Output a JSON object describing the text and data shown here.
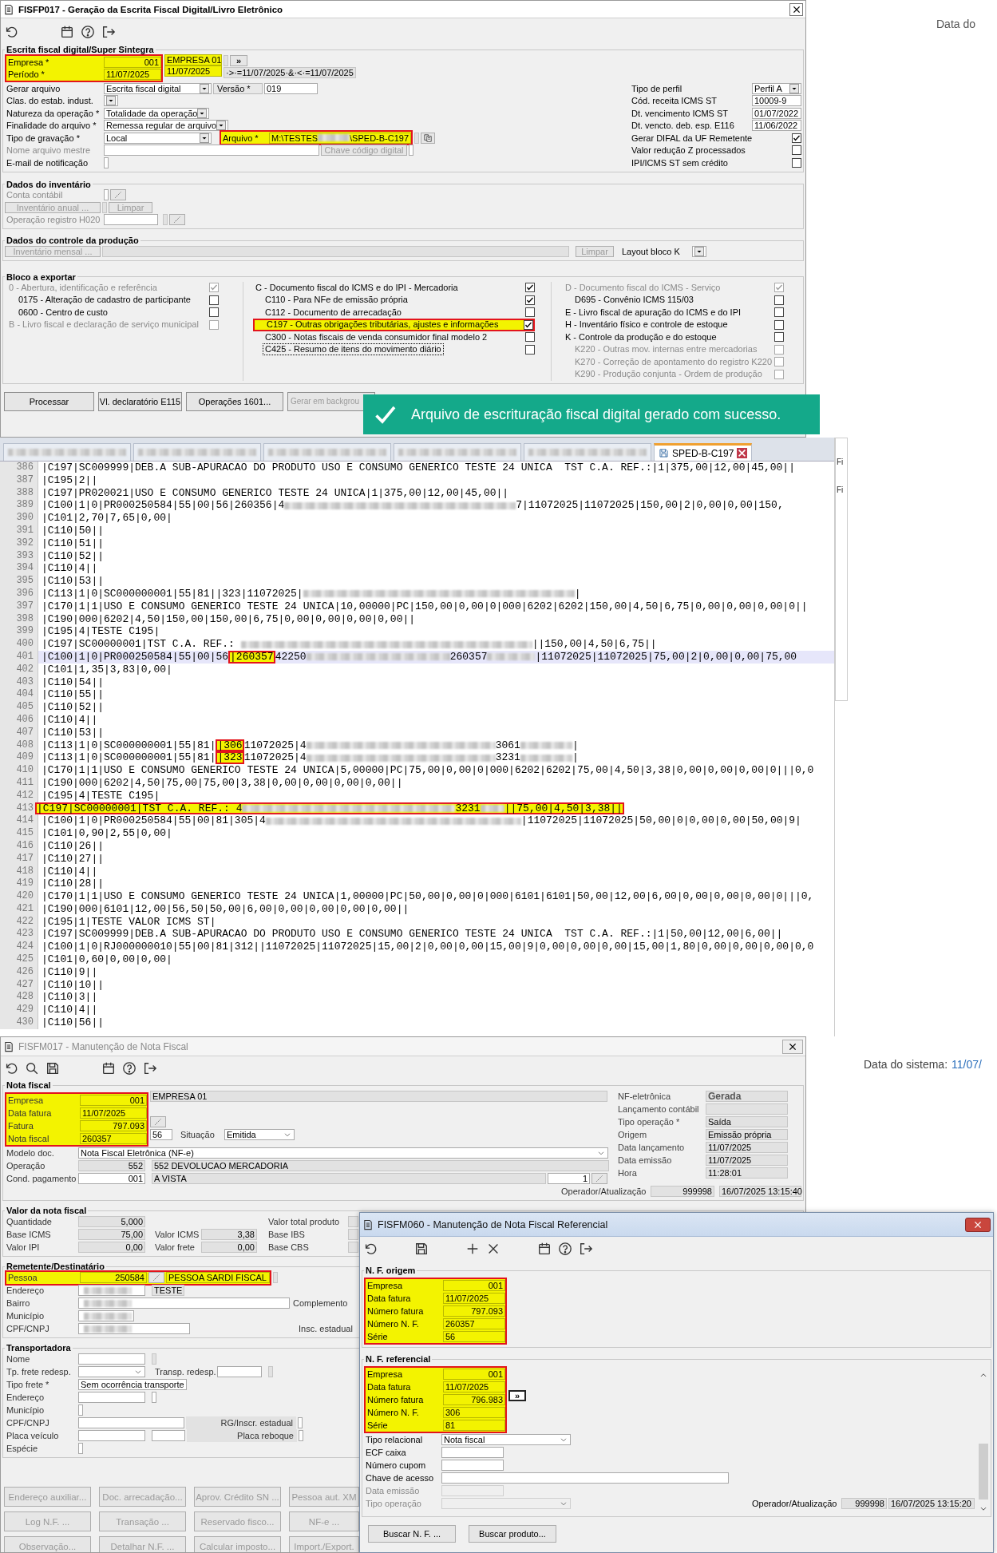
{
  "sped": {
    "title": "FISFP017 - Geração da Escrita Fiscal Digital/Livro Eletrônico",
    "section": "Escrita fiscal digital/Super Sintegra",
    "header": {
      "highlighted": true,
      "empresa": {
        "label": "Empresa *",
        "code": "001",
        "name": "EMPRESA 01"
      },
      "periodo": {
        "label": "Período *",
        "start": "11/07/2025",
        "end": "11/07/2025"
      },
      "filter": "·>·=11/07/2025·&·<·=11/07/2025",
      "expand": "»"
    },
    "gerar_arquivo": {
      "label": "Gerar arquivo",
      "value": "Escrita fiscal digital"
    },
    "versao": {
      "label": "Versão *",
      "value": "019"
    },
    "clas_estab": {
      "label": "Clas. do estab. indust."
    },
    "natureza": {
      "label": "Natureza da operação *",
      "value": "Totalidade da operação"
    },
    "finalidade": {
      "label": "Finalidade do arquivo *",
      "value": "Remessa regular de arquivo"
    },
    "tipo_gravacao": {
      "label": "Tipo de gravação *",
      "value": "Local"
    },
    "arquivo": {
      "label": "Arquivo *",
      "value_start": "M:\\TESTES",
      "value_end": "\\SPED-B-C197",
      "highlighted": true
    },
    "chave": {
      "text": "Chave código digital",
      "disabled": true
    },
    "nome_mestre": {
      "label": "Nome arquivo mestre",
      "disabled": true
    },
    "email": {
      "label": "E-mail de notificação"
    },
    "perfil": [
      {
        "label": "Tipo de perfil",
        "kind": "select",
        "value": "Perfil A"
      },
      {
        "label": "Cód. receita ICMS ST",
        "kind": "field",
        "value": "10009-9"
      },
      {
        "label": "Dt. vencimento ICMS ST",
        "kind": "field",
        "value": "01/07/2022"
      },
      {
        "label": "Dt. vencto. deb. esp. E116",
        "kind": "field",
        "value": "11/06/2022"
      },
      {
        "label": "Gerar DIFAL da UF Remetente",
        "kind": "check",
        "checked": true
      },
      {
        "label": "Valor redução Z processados",
        "kind": "check",
        "checked": false
      },
      {
        "label": "IPI/ICMS ST sem crédito",
        "kind": "check",
        "checked": false
      }
    ],
    "inventario": {
      "title": "Dados do inventário",
      "conta": {
        "label": "Conta contábil",
        "disabled": true
      },
      "anual": {
        "text": "Inventário anual ...",
        "disabled": true
      },
      "limpar": {
        "text": "Limpar",
        "disabled": true
      },
      "h020": {
        "label": "Operação registro H020",
        "disabled": true
      }
    },
    "producao": {
      "title": "Dados do controle da produção",
      "mensal": {
        "text": "Inventário mensal ...",
        "disabled": true
      },
      "limpar": {
        "text": "Limpar",
        "disabled": true
      },
      "layout": {
        "label": "Layout bloco K"
      }
    },
    "blocos": {
      "title": "Bloco a exportar",
      "columns": [
        [
          {
            "label": "0 - Abertura, identificação e referência",
            "checked": true,
            "disabled": true,
            "highlighted": false,
            "focused": false,
            "children": [
              {
                "label": "0175 - Alteração de cadastro de participante",
                "checked": false,
                "disabled": false,
                "highlighted": false,
                "focused": false
              },
              {
                "label": "0600 - Centro de custo",
                "checked": false,
                "disabled": false,
                "highlighted": false,
                "focused": false
              }
            ]
          },
          {
            "label": "B - Livro fiscal e declaração de serviço municipal",
            "checked": false,
            "disabled": true,
            "highlighted": false,
            "focused": false
          }
        ],
        [
          {
            "label": "C - Documento fiscal do ICMS e do IPI - Mercadoria",
            "checked": true,
            "disabled": false,
            "highlighted": false,
            "focused": false,
            "children": [
              {
                "label": "C110 - Para NFe de emissão própria",
                "checked": true,
                "disabled": false,
                "highlighted": false,
                "focused": false
              },
              {
                "label": "C112 - Documento de arrecadação",
                "checked": false,
                "disabled": false,
                "highlighted": false,
                "focused": false
              },
              {
                "label": "C197 - Outras obrigações tributárias, ajustes e informações",
                "checked": true,
                "disabled": false,
                "highlighted": true,
                "focused": false
              },
              {
                "label": "C300 - Notas fiscais de venda consumidor final modelo 2",
                "checked": false,
                "disabled": false,
                "highlighted": false,
                "focused": false
              },
              {
                "label": "C425 - Resumo de itens do movimento diário",
                "checked": false,
                "disabled": false,
                "highlighted": false,
                "focused": true
              }
            ]
          }
        ],
        [
          {
            "label": "D - Documento fiscal do ICMS - Serviço",
            "checked": true,
            "disabled": true,
            "highlighted": false,
            "focused": false,
            "children": [
              {
                "label": "D695 - Convênio ICMS 115/03",
                "checked": false,
                "disabled": false,
                "highlighted": false,
                "focused": false
              }
            ]
          },
          {
            "label": "E - Livro fiscal de apuração do ICMS e do IPI",
            "checked": false,
            "disabled": false,
            "highlighted": false,
            "focused": false
          },
          {
            "label": "H - Inventário físico e controle de estoque",
            "checked": false,
            "disabled": false,
            "highlighted": false,
            "focused": false
          },
          {
            "label": "K - Controle da produção e do estoque",
            "checked": false,
            "disabled": false,
            "highlighted": false,
            "focused": false,
            "children": [
              {
                "label": "K220 - Outras mov. internas entre mercadorias",
                "checked": false,
                "disabled": true,
                "highlighted": false,
                "focused": false
              },
              {
                "label": "K270 - Correção de apontamento do registro K220",
                "checked": false,
                "disabled": true,
                "highlighted": false,
                "focused": false
              },
              {
                "label": "K290 - Produção conjunta - Ordem de produção",
                "checked": false,
                "disabled": true,
                "highlighted": false,
                "focused": false
              }
            ]
          }
        ]
      ]
    },
    "buttons": [
      {
        "text": "Processar",
        "disabled": false
      },
      {
        "text": "Vl. declaratório E115",
        "disabled": false
      },
      {
        "text": "Operações 1601...",
        "disabled": false
      },
      {
        "text": "Gerar em backgrou",
        "disabled": true
      }
    ]
  },
  "toast": {
    "message": "Arquivo de escrituração fiscal digital gerado com sucesso."
  },
  "right_top": {
    "text": "Data do"
  },
  "editor": {
    "tabs": [
      {
        "kind": "redacted",
        "selected": false
      },
      {
        "kind": "redacted",
        "selected": false
      },
      {
        "kind": "redacted",
        "selected": false
      },
      {
        "kind": "redacted",
        "selected": false
      },
      {
        "kind": "redacted",
        "selected": false
      },
      {
        "kind": "file",
        "label": "SPED-B-C197",
        "selected": true
      }
    ],
    "side_labels": [
      "Fi",
      "Fi"
    ],
    "lines": [
      {
        "num": "386",
        "current": false,
        "highlighted": false,
        "segments": [
          {
            "kind": "text",
            "text": "|C197|SC009999|DEB.A SUB-APURACAO DO PRODUTO USO E CONSUMO GENERICO TESTE 24 UNICA  TST C.A. REF.:|1|375,00|12,00|45,00||"
          }
        ]
      },
      {
        "num": "387",
        "current": false,
        "highlighted": false,
        "segments": [
          {
            "kind": "text",
            "text": "|C195|2||"
          }
        ]
      },
      {
        "num": "388",
        "current": false,
        "highlighted": false,
        "segments": [
          {
            "kind": "text",
            "text": "|C197|PR020021|USO E CONSUMO GENERICO TESTE 24 UNICA|1|375,00|12,00|45,00||"
          }
        ]
      },
      {
        "num": "389",
        "current": false,
        "highlighted": false,
        "segments": [
          {
            "kind": "text",
            "text": "|C100|1|0|PR000250584|55|00|56|260356|4"
          },
          {
            "kind": "redacted"
          },
          {
            "kind": "text",
            "text": "7|11072025|11072025|150,00|2|0,00|0,00|150,"
          }
        ]
      },
      {
        "num": "390",
        "current": false,
        "highlighted": false,
        "segments": [
          {
            "kind": "text",
            "text": "|C101|2,70|7,65|0,00|"
          }
        ]
      },
      {
        "num": "391",
        "current": false,
        "highlighted": false,
        "segments": [
          {
            "kind": "text",
            "text": "|C110|50||"
          }
        ]
      },
      {
        "num": "392",
        "current": false,
        "highlighted": false,
        "segments": [
          {
            "kind": "text",
            "text": "|C110|51||"
          }
        ]
      },
      {
        "num": "393",
        "current": false,
        "highlighted": false,
        "segments": [
          {
            "kind": "text",
            "text": "|C110|52||"
          }
        ]
      },
      {
        "num": "394",
        "current": false,
        "highlighted": false,
        "segments": [
          {
            "kind": "text",
            "text": "|C110|4||"
          }
        ]
      },
      {
        "num": "395",
        "current": false,
        "highlighted": false,
        "segments": [
          {
            "kind": "text",
            "text": "|C110|53||"
          }
        ]
      },
      {
        "num": "396",
        "current": false,
        "highlighted": false,
        "segments": [
          {
            "kind": "text",
            "text": "|C113|1|0|SC000000001|55|81||323|11072025|"
          },
          {
            "kind": "redacted"
          },
          {
            "kind": "text",
            "text": "|"
          }
        ]
      },
      {
        "num": "397",
        "current": false,
        "highlighted": false,
        "segments": [
          {
            "kind": "text",
            "text": "|C170|1|1|USO E CONSUMO GENERICO TESTE 24 UNICA|10,00000|PC|150,00|0,00|0|000|6202|6202|150,00|4,50|6,75|0,00|0,00|0,00|0||"
          }
        ]
      },
      {
        "num": "398",
        "current": false,
        "highlighted": false,
        "segments": [
          {
            "kind": "text",
            "text": "|C190|000|6202|4,50|150,00|150,00|6,75|0,00|0,00|0,00|0,00||"
          }
        ]
      },
      {
        "num": "399",
        "current": false,
        "highlighted": false,
        "segments": [
          {
            "kind": "text",
            "text": "|C195|4|TESTE C195|"
          }
        ]
      },
      {
        "num": "400",
        "current": false,
        "highlighted": false,
        "segments": [
          {
            "kind": "text",
            "text": "|C197|SC00000001|TST C.A. REF.: "
          },
          {
            "kind": "redacted"
          },
          {
            "kind": "text",
            "text": "||150,00|4,50|6,75||"
          }
        ]
      },
      {
        "num": "401",
        "current": true,
        "highlighted": false,
        "segments": [
          {
            "kind": "text",
            "text": "|C100|1|0|PR000250584|55|00|56"
          },
          {
            "kind": "mark",
            "text": "|260357"
          },
          {
            "kind": "text",
            "text": "42250"
          },
          {
            "kind": "redacted"
          },
          {
            "kind": "text",
            "text": "260357"
          },
          {
            "kind": "redacted"
          },
          {
            "kind": "text",
            "text": "|11072025|11072025|75,00|2|0,00|0,00|75,00"
          }
        ]
      },
      {
        "num": "402",
        "current": false,
        "highlighted": false,
        "segments": [
          {
            "kind": "text",
            "text": "|C101|1,35|3,83|0,00|"
          }
        ]
      },
      {
        "num": "403",
        "current": false,
        "highlighted": false,
        "segments": [
          {
            "kind": "text",
            "text": "|C110|54||"
          }
        ]
      },
      {
        "num": "404",
        "current": false,
        "highlighted": false,
        "segments": [
          {
            "kind": "text",
            "text": "|C110|55||"
          }
        ]
      },
      {
        "num": "405",
        "current": false,
        "highlighted": false,
        "segments": [
          {
            "kind": "text",
            "text": "|C110|52||"
          }
        ]
      },
      {
        "num": "406",
        "current": false,
        "highlighted": false,
        "segments": [
          {
            "kind": "text",
            "text": "|C110|4||"
          }
        ]
      },
      {
        "num": "407",
        "current": false,
        "highlighted": false,
        "segments": [
          {
            "kind": "text",
            "text": "|C110|53||"
          }
        ]
      },
      {
        "num": "408",
        "current": false,
        "highlighted": false,
        "segments": [
          {
            "kind": "text",
            "text": "|C113|1|0|SC000000001|55|81|"
          },
          {
            "kind": "mark",
            "text": "|306"
          },
          {
            "kind": "text",
            "text": "11072025|4"
          },
          {
            "kind": "redacted"
          },
          {
            "kind": "text",
            "text": "3061"
          },
          {
            "kind": "redacted"
          },
          {
            "kind": "text",
            "text": "|"
          }
        ]
      },
      {
        "num": "409",
        "current": false,
        "highlighted": false,
        "segments": [
          {
            "kind": "text",
            "text": "|C113|1|0|SC000000001|55|81|"
          },
          {
            "kind": "mark",
            "text": "|323"
          },
          {
            "kind": "text",
            "text": "11072025|4"
          },
          {
            "kind": "redacted"
          },
          {
            "kind": "text",
            "text": "3231"
          },
          {
            "kind": "redacted"
          },
          {
            "kind": "text",
            "text": "|"
          }
        ]
      },
      {
        "num": "410",
        "current": false,
        "highlighted": false,
        "segments": [
          {
            "kind": "text",
            "text": "|C170|1|1|USO E CONSUMO GENERICO TESTE 24 UNICA|5,00000|PC|75,00|0,00|0|000|6202|6202|75,00|4,50|3,38|0,00|0,00|0,00|0|||0,0"
          }
        ]
      },
      {
        "num": "411",
        "current": false,
        "highlighted": false,
        "segments": [
          {
            "kind": "text",
            "text": "|C190|000|6202|4,50|75,00|75,00|3,38|0,00|0,00|0,00|0,00||"
          }
        ]
      },
      {
        "num": "412",
        "current": false,
        "highlighted": false,
        "segments": [
          {
            "kind": "text",
            "text": "|C195|4|TESTE C195|"
          }
        ]
      },
      {
        "num": "413",
        "current": false,
        "highlighted": true,
        "segments": [
          {
            "kind": "text",
            "text": "|C197|SC00000001|TST C.A. REF.: 4"
          },
          {
            "kind": "redacted"
          },
          {
            "kind": "text",
            "text": "3231"
          },
          {
            "kind": "redacted"
          },
          {
            "kind": "text",
            "text": "||75,00|4,50|3,38||"
          }
        ]
      },
      {
        "num": "414",
        "current": false,
        "highlighted": false,
        "segments": [
          {
            "kind": "text",
            "text": "|C100|1|0|PR000250584|55|00|81|305|4"
          },
          {
            "kind": "redacted"
          },
          {
            "kind": "text",
            "text": "|11072025|11072025|50,00|0|0,00|0,00|50,00|9|"
          }
        ]
      },
      {
        "num": "415",
        "current": false,
        "highlighted": false,
        "segments": [
          {
            "kind": "text",
            "text": "|C101|0,90|2,55|0,00|"
          }
        ]
      },
      {
        "num": "416",
        "current": false,
        "highlighted": false,
        "segments": [
          {
            "kind": "text",
            "text": "|C110|26||"
          }
        ]
      },
      {
        "num": "417",
        "current": false,
        "highlighted": false,
        "segments": [
          {
            "kind": "text",
            "text": "|C110|27||"
          }
        ]
      },
      {
        "num": "418",
        "current": false,
        "highlighted": false,
        "segments": [
          {
            "kind": "text",
            "text": "|C110|4||"
          }
        ]
      },
      {
        "num": "419",
        "current": false,
        "highlighted": false,
        "segments": [
          {
            "kind": "text",
            "text": "|C110|28||"
          }
        ]
      },
      {
        "num": "420",
        "current": false,
        "highlighted": false,
        "segments": [
          {
            "kind": "text",
            "text": "|C170|1|1|USO E CONSUMO GENERICO TESTE 24 UNICA|1,00000|PC|50,00|0,00|0|000|6101|6101|50,00|12,00|6,00|0,00|0,00|0,00|0|||0,"
          }
        ]
      },
      {
        "num": "421",
        "current": false,
        "highlighted": false,
        "segments": [
          {
            "kind": "text",
            "text": "|C190|000|6101|12,00|56,50|50,00|6,00|0,00|0,00|0,00|0,00||"
          }
        ]
      },
      {
        "num": "422",
        "current": false,
        "highlighted": false,
        "segments": [
          {
            "kind": "text",
            "text": "|C195|1|TESTE VALOR ICMS ST|"
          }
        ]
      },
      {
        "num": "423",
        "current": false,
        "highlighted": false,
        "segments": [
          {
            "kind": "text",
            "text": "|C197|SC009999|DEB.A SUB-APURACAO DO PRODUTO USO E CONSUMO GENERICO TESTE 24 UNICA  TST C.A. REF.:|1|50,00|12,00|6,00||"
          }
        ]
      },
      {
        "num": "424",
        "current": false,
        "highlighted": false,
        "segments": [
          {
            "kind": "text",
            "text": "|C100|1|0|RJ000000010|55|00|81|312||11072025|11072025|15,00|2|0,00|0,00|15,00|9|0,00|0,00|0,00|15,00|1,80|0,00|0,00|0,00|0,0"
          }
        ]
      },
      {
        "num": "425",
        "current": false,
        "highlighted": false,
        "segments": [
          {
            "kind": "text",
            "text": "|C101|0,60|0,00|0,00|"
          }
        ]
      },
      {
        "num": "426",
        "current": false,
        "highlighted": false,
        "segments": [
          {
            "kind": "text",
            "text": "|C110|9||"
          }
        ]
      },
      {
        "num": "427",
        "current": false,
        "highlighted": false,
        "segments": [
          {
            "kind": "text",
            "text": "|C110|10||"
          }
        ]
      },
      {
        "num": "428",
        "current": false,
        "highlighted": false,
        "segments": [
          {
            "kind": "text",
            "text": "|C110|3||"
          }
        ]
      },
      {
        "num": "429",
        "current": false,
        "highlighted": false,
        "segments": [
          {
            "kind": "text",
            "text": "|C110|4||"
          }
        ]
      },
      {
        "num": "430",
        "current": false,
        "highlighted": false,
        "segments": [
          {
            "kind": "text",
            "text": "|C110|56||"
          }
        ]
      }
    ]
  },
  "nf_window": {
    "title": "FISFM017 - Manutenção de Nota Fiscal",
    "nota": {
      "title": "Nota fiscal",
      "highlighted": true,
      "empresa": {
        "label": "Empresa",
        "code": "001",
        "name": "EMPRESA 01"
      },
      "data_fatura": {
        "label": "Data fatura",
        "value": "11/07/2025"
      },
      "fatura": {
        "label": "Fatura",
        "value": "797.093"
      },
      "nota_fiscal": {
        "label": "Nota fiscal",
        "value": "260357",
        "serie": "56"
      },
      "situacao": {
        "label": "Situação",
        "value": "Emitida"
      },
      "modelo": {
        "label": "Modelo doc.",
        "value": "Nota Fiscal Eletrônica (NF-e)"
      },
      "operacao": {
        "label": "Operação",
        "code": "552",
        "name": "552 DEVOLUCAO MERCADORIA"
      },
      "cond_pagamento": {
        "label": "Cond. pagamento",
        "code": "001",
        "name": "A VISTA",
        "parcelas": "1"
      },
      "side": [
        {
          "label": "NF-eletrônica",
          "kind": "status",
          "value": "Gerada"
        },
        {
          "label": "Lançamento contábil",
          "kind": "field"
        },
        {
          "label": "Tipo operação *",
          "kind": "field",
          "value": "Saída"
        },
        {
          "label": "Origem",
          "kind": "field",
          "value": "Emissão própria"
        },
        {
          "label": "Data lançamento",
          "kind": "field",
          "value": "11/07/2025"
        },
        {
          "label": "Data emissão",
          "kind": "field",
          "value": "11/07/2025"
        },
        {
          "label": "Hora",
          "kind": "field",
          "value": "11:28:01"
        }
      ],
      "operador": {
        "label": "Operador/Atualização",
        "code": "999998",
        "timestamp": "16/07/2025 13:15:40"
      }
    },
    "valores": {
      "title": "Valor da nota fiscal",
      "col1": [
        {
          "label": "Quantidade",
          "value": "5,000"
        },
        {
          "label": "Base ICMS",
          "value": "75,00"
        },
        {
          "label": "Valor IPI",
          "value": "0,00"
        }
      ],
      "col2": [
        {
          "label": "Valor ICMS",
          "value": "3,38"
        },
        {
          "label": "Valor frete",
          "value": "0,00"
        }
      ],
      "col3": [
        {
          "label": "Valor total produto"
        },
        {
          "label": "Base IBS"
        },
        {
          "label": "Base CBS"
        }
      ]
    },
    "remetente": {
      "title": "Remetente/Destinatário",
      "highlighted": true,
      "pessoa": {
        "label": "Pessoa",
        "code": "250584",
        "name": "PESSOA SARDI FISCAL"
      },
      "endereco": {
        "label": "Endereço",
        "complement": "TESTE"
      },
      "bairro": {
        "label": "Bairro",
        "complemento_label": "Complemento"
      },
      "municipio": {
        "label": "Município"
      },
      "cpf": {
        "label": "CPF/CNPJ",
        "ie_label": "Insc. estadual"
      }
    },
    "transportadora": {
      "title": "Transportadora",
      "nome": "Nome",
      "tp_frete_redesp": "Tp. frete redesp.",
      "transp_redesp": "Transp. redesp.",
      "tipo_frete": {
        "label": "Tipo frete *",
        "value": "Sem ocorrência transporte"
      },
      "endereco": "Endereço",
      "municipio": "Município",
      "cpf": "CPF/CNPJ",
      "rg": "RG/Inscr. estadual",
      "placa": "Placa veículo",
      "reboque": "Placa reboque",
      "especie": "Espécie"
    },
    "buttons": [
      {
        "text": "Endereço auxiliar...",
        "disabled": true
      },
      {
        "text": "Doc. arrecadação...",
        "disabled": true
      },
      {
        "text": "Aprov. Crédito SN ...",
        "disabled": true
      },
      {
        "text": "Pessoa aut. XM",
        "disabled": true
      },
      {
        "text": "Log N.F. ...",
        "disabled": true
      },
      {
        "text": "Transação ...",
        "disabled": true
      },
      {
        "text": "Reservado fisco...",
        "disabled": true
      },
      {
        "text": "NF-e ...",
        "disabled": true
      },
      {
        "text": "Observação...",
        "disabled": true
      },
      {
        "text": "Detalhar N.F. ...",
        "disabled": true
      },
      {
        "text": "Calcular imposto...",
        "disabled": true
      },
      {
        "text": "Import./Export.",
        "disabled": true
      }
    ]
  },
  "right_bottom": {
    "label": "Data do sistema:",
    "value": "11/07/"
  },
  "ref_window": {
    "title": "FISFM060 - Manutenção de Nota Fiscal Referencial",
    "origem": {
      "title": "N. F. origem",
      "highlighted": true,
      "fields": [
        {
          "label": "Empresa",
          "kind": "number",
          "value": "001"
        },
        {
          "label": "Data fatura",
          "kind": "text",
          "value": "11/07/2025"
        },
        {
          "label": "Número fatura",
          "kind": "number",
          "value": "797.093"
        },
        {
          "label": "Número N. F.",
          "kind": "text",
          "value": "260357"
        },
        {
          "label": "Série",
          "kind": "text",
          "value": "56"
        }
      ]
    },
    "referencial": {
      "title": "N. F. referencial",
      "highlighted": true,
      "fields": [
        {
          "label": "Empresa",
          "kind": "number",
          "value": "001"
        },
        {
          "label": "Data fatura",
          "kind": "text",
          "value": "11/07/2025"
        },
        {
          "label": "Número fatura",
          "kind": "number",
          "value": "796.983"
        },
        {
          "label": "Número N. F.",
          "kind": "text",
          "value": "306"
        },
        {
          "label": "Série",
          "kind": "text",
          "value": "81"
        }
      ],
      "expand": "»",
      "tipo_relacional": {
        "label": "Tipo relacional",
        "value": "Nota fiscal"
      },
      "ecf": {
        "label": "ECF caixa"
      },
      "cupom": {
        "label": "Número cupom"
      },
      "chave": {
        "label": "Chave de acesso"
      },
      "data_emissao": {
        "label": "Data emissão",
        "disabled": true
      },
      "tipo_operacao": {
        "label": "Tipo operação",
        "disabled": true
      },
      "operador": {
        "label": "Operador/Atualização",
        "code": "999998",
        "timestamp": "16/07/2025 13:15:20"
      }
    },
    "buttons": [
      "Buscar N. F. ...",
      "Buscar produto..."
    ]
  }
}
